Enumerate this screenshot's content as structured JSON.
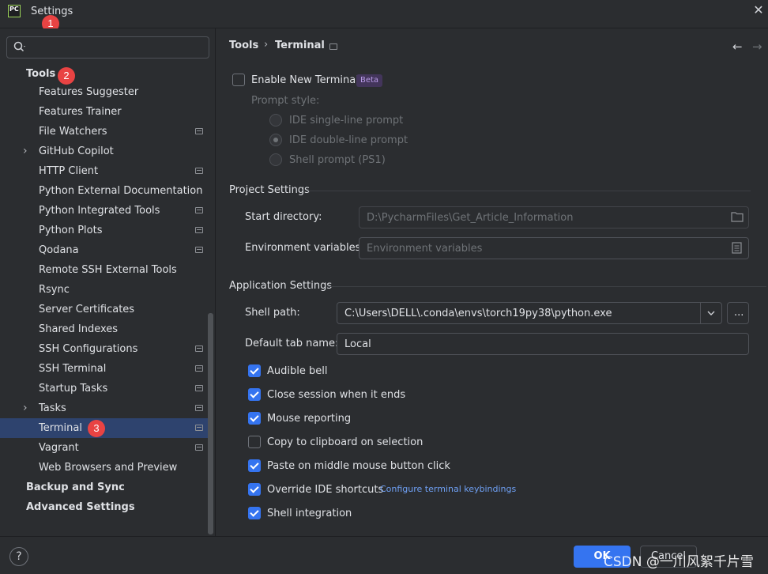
{
  "window": {
    "title": "Settings",
    "logo_text": "PC",
    "close_glyph": "✕"
  },
  "badges": [
    "1",
    "2",
    "3"
  ],
  "search": {
    "placeholder": ""
  },
  "nav": {
    "section": "Tools",
    "items": [
      {
        "label": "Features Suggester",
        "marked": false,
        "expandable": false
      },
      {
        "label": "Features Trainer",
        "marked": false,
        "expandable": false
      },
      {
        "label": "File Watchers",
        "marked": true,
        "expandable": false
      },
      {
        "label": "GitHub Copilot",
        "marked": false,
        "expandable": true
      },
      {
        "label": "HTTP Client",
        "marked": true,
        "expandable": false
      },
      {
        "label": "Python External Documentation",
        "marked": false,
        "expandable": false
      },
      {
        "label": "Python Integrated Tools",
        "marked": true,
        "expandable": false
      },
      {
        "label": "Python Plots",
        "marked": true,
        "expandable": false
      },
      {
        "label": "Qodana",
        "marked": true,
        "expandable": false
      },
      {
        "label": "Remote SSH External Tools",
        "marked": false,
        "expandable": false
      },
      {
        "label": "Rsync",
        "marked": false,
        "expandable": false
      },
      {
        "label": "Server Certificates",
        "marked": false,
        "expandable": false
      },
      {
        "label": "Shared Indexes",
        "marked": false,
        "expandable": false
      },
      {
        "label": "SSH Configurations",
        "marked": true,
        "expandable": false
      },
      {
        "label": "SSH Terminal",
        "marked": true,
        "expandable": false
      },
      {
        "label": "Startup Tasks",
        "marked": true,
        "expandable": false
      },
      {
        "label": "Tasks",
        "marked": true,
        "expandable": true
      },
      {
        "label": "Terminal",
        "marked": true,
        "expandable": false,
        "selected": true
      },
      {
        "label": "Vagrant",
        "marked": true,
        "expandable": false
      },
      {
        "label": "Web Browsers and Preview",
        "marked": false,
        "expandable": false
      }
    ],
    "bottom": [
      "Backup and Sync",
      "Advanced Settings"
    ]
  },
  "breadcrumb": {
    "parent": "Tools",
    "separator": "›",
    "current": "Terminal"
  },
  "nav_arrows": {
    "back": "←",
    "forward": "→"
  },
  "new_terminal": {
    "label": "Enable New Terminal",
    "checked": false,
    "badge": "Beta",
    "prompt_style_label": "Prompt style:",
    "options": [
      "IDE single-line prompt",
      "IDE double-line prompt",
      "Shell prompt (PS1)"
    ],
    "selected_option": 1
  },
  "project_settings": {
    "title": "Project Settings",
    "start_directory_label": "Start directory:",
    "start_directory_value": "D:\\PycharmFiles\\Get_Article_Information",
    "env_vars_label": "Environment variables:",
    "env_vars_placeholder": "Environment variables"
  },
  "application_settings": {
    "title": "Application Settings",
    "shell_path_label": "Shell path:",
    "shell_path_value": "C:\\Users\\DELL\\.conda\\envs\\torch19py38\\python.exe",
    "browse_label": "...",
    "tab_name_label": "Default tab name:",
    "tab_name_value": "Local",
    "options": [
      {
        "label": "Audible bell",
        "checked": true
      },
      {
        "label": "Close session when it ends",
        "checked": true
      },
      {
        "label": "Mouse reporting",
        "checked": true
      },
      {
        "label": "Copy to clipboard on selection",
        "checked": false
      },
      {
        "label": "Paste on middle mouse button click",
        "checked": true
      },
      {
        "label": "Override IDE shortcuts",
        "checked": true
      },
      {
        "label": "Shell integration",
        "checked": true
      }
    ],
    "keybindings_link": "Configure terminal keybindings"
  },
  "footer": {
    "help": "?",
    "ok": "OK",
    "cancel": "Cancel"
  },
  "watermark": "CSDN @一川风絮千片雪",
  "colors": {
    "accent": "#3574f0",
    "background": "#2b2d30",
    "selection": "#2e436e",
    "badge": "#e94343"
  }
}
